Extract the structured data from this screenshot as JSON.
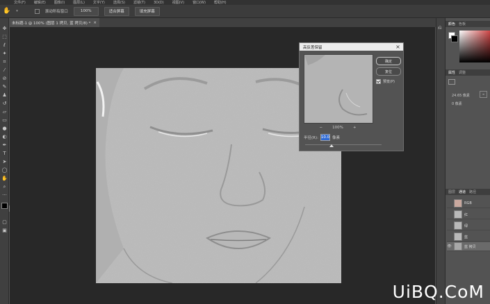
{
  "menubar": {
    "items": [
      "文件(F)",
      "编辑(E)",
      "图像(I)",
      "图层(L)",
      "文字(Y)",
      "选择(S)",
      "滤镜(T)",
      "3D(D)",
      "视图(V)",
      "窗口(W)",
      "帮助(H)"
    ]
  },
  "options_bar": {
    "scroll_all_label": "滚动所有窗口",
    "zoom_value": "100%",
    "fit_screen_label": "适合屏幕",
    "fill_screen_label": "填充屏幕"
  },
  "document_tab": {
    "title": "未标题-1 @ 100% (图层 1 拷贝, 蓝 拷贝/8) *",
    "close_glyph": "×"
  },
  "dialog": {
    "title": "高反差保留",
    "close_glyph": "×",
    "ok_label": "确定",
    "reset_label": "复位",
    "preview_label": "预览(P)",
    "zoom_out_glyph": "−",
    "zoom_in_glyph": "+",
    "zoom_value": "100%",
    "radius_label": "半径(R):",
    "radius_value": "10.0",
    "radius_unit": "像素"
  },
  "right_panel": {
    "color_tabs": [
      "颜色",
      "色板"
    ],
    "properties_tabs": [
      "属性",
      "调整"
    ],
    "properties": {
      "row1": "24.65 像素",
      "row2": "0 像素"
    },
    "channel_tabs": [
      "图层",
      "通道",
      "路径"
    ],
    "channels": [
      {
        "name": "RGB",
        "visible": false
      },
      {
        "name": "红",
        "visible": false
      },
      {
        "name": "绿",
        "visible": false
      },
      {
        "name": "蓝",
        "visible": false
      },
      {
        "name": "蓝 拷贝",
        "visible": true
      }
    ]
  },
  "watermark": "UiBQ.CoM"
}
